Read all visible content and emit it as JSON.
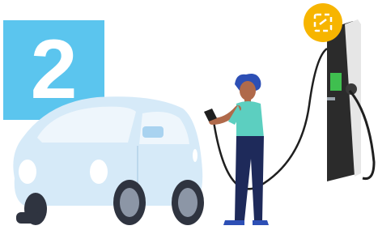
{
  "step": {
    "number": "2",
    "badge_color": "#5bc5ee"
  },
  "icons": {
    "charger_badge": "charging-connector-icon",
    "charger_badge_color": "#f7b500"
  },
  "colors": {
    "car_body": "#d6eaf8",
    "person_shirt": "#5ccfc0",
    "person_pants": "#1e2a5a",
    "charger_body": "#2b2b2b",
    "charger_screen": "#3fbf4f"
  }
}
